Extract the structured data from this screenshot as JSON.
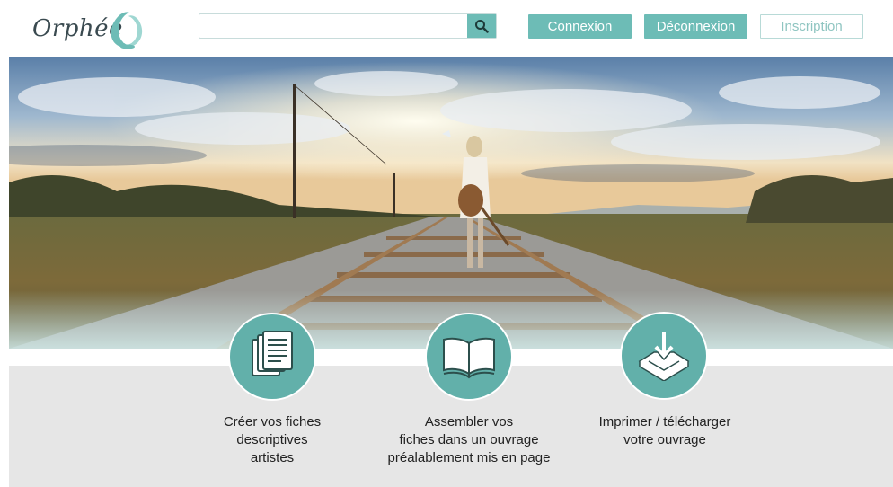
{
  "header": {
    "logo_text": "Orphée",
    "search": {
      "value": "",
      "placeholder": ""
    },
    "buttons": {
      "connexion": "Connexion",
      "deconnexion": "Déconnexion",
      "inscription": "Inscription"
    }
  },
  "hero": {
    "image": "woman-with-guitar-on-railway-tracks"
  },
  "features": [
    {
      "icon": "documents-icon",
      "label": "Créer vos fiches\ndescriptives\nartistes"
    },
    {
      "icon": "open-book-icon",
      "label": "Assembler vos\nfiches dans un ouvrage\npréalablement mis en page"
    },
    {
      "icon": "download-tray-icon",
      "label": "Imprimer / télécharger\nvotre ouvrage"
    }
  ],
  "colors": {
    "accent": "#6dbcb6",
    "accent_dark": "#62b0aa",
    "panel": "#e6e6e6",
    "text": "#222222"
  }
}
